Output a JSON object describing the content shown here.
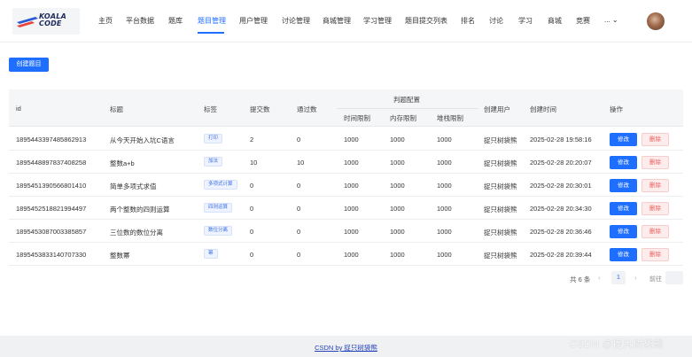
{
  "logo": {
    "line1": "KOALA",
    "line2": "CODE"
  },
  "nav": {
    "items": [
      "主页",
      "平台数据",
      "题库",
      "题目管理",
      "用户管理",
      "讨论管理",
      "商城管理",
      "学习管理",
      "题目提交列表",
      "排名",
      "讨论",
      "学习",
      "商城",
      "竞赛"
    ],
    "active": "题目管理",
    "more_label": "... ⌄"
  },
  "create_button": "创建题目",
  "table": {
    "headers": {
      "id": "id",
      "title": "标题",
      "tags": "标签",
      "submit": "提交数",
      "pass": "通过数",
      "judge": "判题配置",
      "time": "时间限制",
      "memory": "内存限制",
      "stack": "堆栈限制",
      "creator": "创建用户",
      "created": "创建时间",
      "ops": "操作"
    },
    "rows": [
      {
        "id": "1895443397485862913",
        "title": "从今天开始入坑C语言",
        "tag": "打印",
        "submit": "2",
        "pass": "0",
        "time": "1000",
        "memory": "1000",
        "stack": "1000",
        "creator": "捉只树袋熊",
        "created": "2025-02-28 19:58:16"
      },
      {
        "id": "1895448897837408258",
        "title": "整数a+b",
        "tag": "加法",
        "submit": "10",
        "pass": "10",
        "time": "1000",
        "memory": "1000",
        "stack": "1000",
        "creator": "捉只树袋熊",
        "created": "2025-02-28 20:20:07"
      },
      {
        "id": "1895451390566801410",
        "title": "简单多项式求值",
        "tag": "多项式计算",
        "submit": "0",
        "pass": "0",
        "time": "1000",
        "memory": "1000",
        "stack": "1000",
        "creator": "捉只树袋熊",
        "created": "2025-02-28 20:30:01"
      },
      {
        "id": "1895452518821994497",
        "title": "两个整数的四则运算",
        "tag": "四则运算",
        "submit": "0",
        "pass": "0",
        "time": "1000",
        "memory": "1000",
        "stack": "1000",
        "creator": "捉只树袋熊",
        "created": "2025-02-28 20:34:30"
      },
      {
        "id": "1895453087003385857",
        "title": "三位数的数位分离",
        "tag": "数位分离",
        "submit": "0",
        "pass": "0",
        "time": "1000",
        "memory": "1000",
        "stack": "1000",
        "creator": "捉只树袋熊",
        "created": "2025-02-28 20:36:46"
      },
      {
        "id": "1895453833140707330",
        "title": "整数幂",
        "tag": "幂",
        "submit": "0",
        "pass": "0",
        "time": "1000",
        "memory": "1000",
        "stack": "1000",
        "creator": "捉只树袋熊",
        "created": "2025-02-28 20:39:44"
      }
    ],
    "edit_label": "修改",
    "delete_label": "删除"
  },
  "pagination": {
    "total": "共 6 条",
    "prev": "‹",
    "page": "1",
    "next": "›",
    "goto": "前往"
  },
  "footer": {
    "link": "CSDN by 捉只树袋熊"
  },
  "watermark": "CSDN @捉只树袋熊",
  "colors": {
    "primary": "#1e6fff",
    "danger": "#f05a5a",
    "tag_bg": "#eef3ff"
  }
}
